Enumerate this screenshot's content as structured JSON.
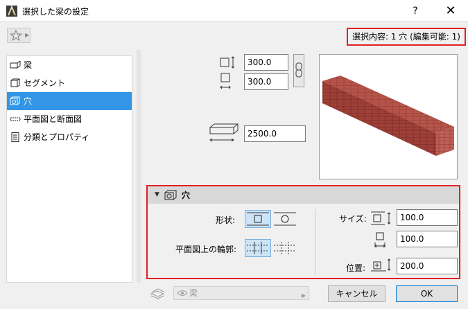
{
  "window": {
    "title": "選択した梁の設定",
    "help": "?",
    "close": "✕"
  },
  "selection_info": "選択内容: 1 穴 (編集可能: 1)",
  "sidebar": {
    "items": [
      {
        "label": "梁",
        "icon": "beam-icon"
      },
      {
        "label": "セグメント",
        "icon": "segment-icon"
      },
      {
        "label": "穴",
        "icon": "hole-icon"
      },
      {
        "label": "平面図と断面図",
        "icon": "floorplan-section-icon"
      },
      {
        "label": "分類とプロパティ",
        "icon": "classification-icon"
      }
    ],
    "active_index": 2
  },
  "geometry": {
    "width": "300.0",
    "height": "300.0",
    "length": "2500.0"
  },
  "hole_panel": {
    "title": "穴",
    "shape_label": "形状:",
    "outline_label": "平面図上の輪郭:",
    "size_label": "サイズ:",
    "position_label": "位置:",
    "size_width": "100.0",
    "size_height": "100.0",
    "position": "200.0",
    "shape_selected": "rectangle",
    "outline_selected": "dashed"
  },
  "bottom": {
    "layer": "梁",
    "cancel": "キャンセル",
    "ok": "OK"
  },
  "colors": {
    "accent": "#3395e6",
    "highlight_border": "#e02020",
    "brick": "#a8453e"
  }
}
